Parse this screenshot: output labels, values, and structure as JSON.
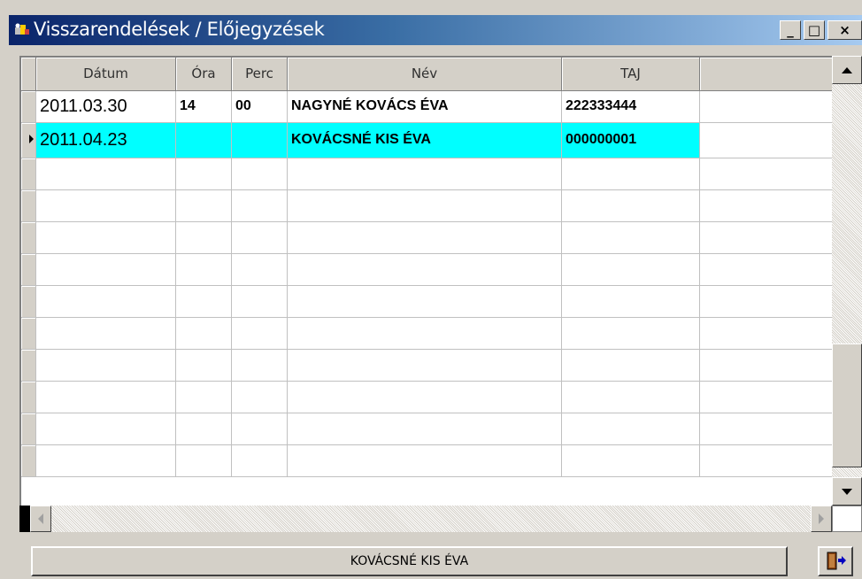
{
  "window": {
    "title": "Visszarendelések / Előjegyzések",
    "minimize_label": "_",
    "maximize_label": "□",
    "close_label": "×"
  },
  "grid": {
    "columns": [
      "Dátum",
      "Óra",
      "Perc",
      "Név",
      "TAJ",
      ""
    ],
    "rows": [
      {
        "datum": "2011.03.30",
        "ora": "14",
        "perc": "00",
        "nev": "NAGYNÉ KOVÁCS ÉVA",
        "taj": "222333444",
        "selected": false
      },
      {
        "datum": "2011.04.23",
        "ora": "",
        "perc": "",
        "nev": "KOVÁCSNÉ KIS ÉVA",
        "taj": "000000001",
        "selected": true
      }
    ],
    "empty_rows": 10
  },
  "status_button_label": "KOVÁCSNÉ KIS ÉVA",
  "icons": {
    "app": "app-icon",
    "exit": "exit-door-icon",
    "scroll_up": "arrow-up-icon",
    "scroll_down": "arrow-down-icon",
    "scroll_left": "arrow-left-icon",
    "scroll_right": "arrow-right-icon",
    "row_indicator": "row-pointer-icon"
  },
  "colors": {
    "selection": "#00ffff",
    "titlebar_start": "#0a246a",
    "titlebar_end": "#a6caf0"
  }
}
